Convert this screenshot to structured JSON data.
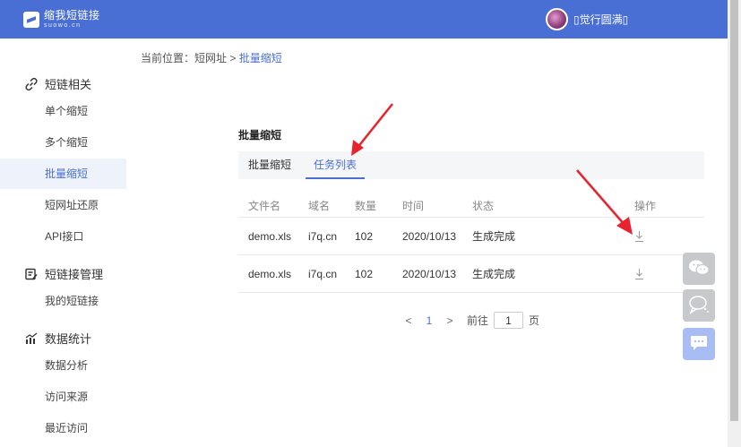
{
  "header": {
    "logo_cn": "缩我短链接",
    "logo_en": "suowo.cn",
    "username": "▯觉行圆满▯"
  },
  "sidebar": {
    "sections": [
      {
        "label": "短链相关",
        "icon": "link-icon",
        "items": [
          "单个缩短",
          "多个缩短",
          "批量缩短",
          "短网址还原",
          "API接口"
        ]
      },
      {
        "label": "短链接管理",
        "icon": "edit-icon",
        "items": [
          "我的短链接"
        ]
      },
      {
        "label": "数据统计",
        "icon": "bar-chart-icon",
        "items": [
          "数据分析",
          "访问来源",
          "最近访问"
        ]
      }
    ],
    "active_item": "批量缩短"
  },
  "breadcrumb": {
    "prefix": "当前位置：短网址 > ",
    "current": "批量缩短"
  },
  "panel": {
    "title": "批量缩短",
    "tabs": [
      "批量缩短",
      "任务列表"
    ],
    "active_tab": "任务列表"
  },
  "table": {
    "columns": [
      "文件名",
      "域名",
      "数量",
      "时间",
      "状态",
      "操作"
    ],
    "rows": [
      {
        "file": "demo.xls",
        "domain": "i7q.cn",
        "count": "102",
        "time": "2020/10/13",
        "status": "生成完成",
        "action_icon": "download-icon"
      },
      {
        "file": "demo.xls",
        "domain": "i7q.cn",
        "count": "102",
        "time": "2020/10/13",
        "status": "生成完成",
        "action_icon": "download-icon"
      }
    ]
  },
  "pagination": {
    "prev": "<",
    "current_page": "1",
    "next": ">",
    "goto_label": "前往",
    "goto_value": "1",
    "page_suffix": "页"
  },
  "floating": [
    "wechat-icon",
    "chat-bubble-icon",
    "message-icon"
  ],
  "colors": {
    "accent": "#4a6fd4",
    "annotation": "#e8232e"
  }
}
